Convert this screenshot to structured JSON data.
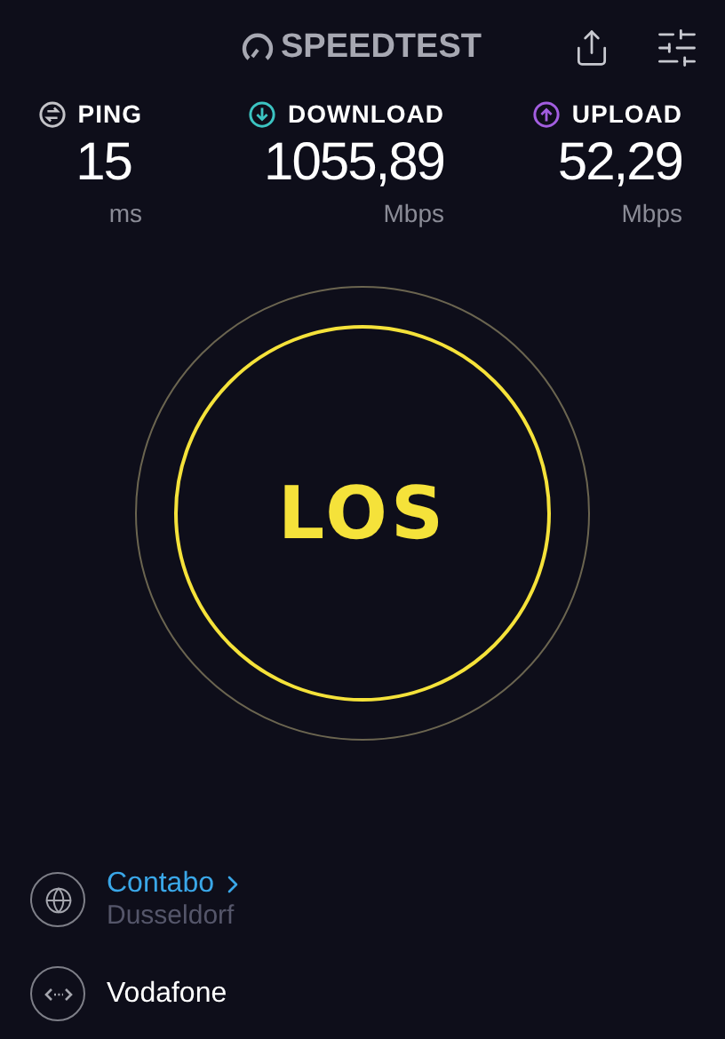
{
  "header": {
    "logo": "SPEEDTEST"
  },
  "metrics": [
    {
      "kind": "ping",
      "label": "PING",
      "value": "15",
      "unit": "ms"
    },
    {
      "kind": "download",
      "label": "DOWNLOAD",
      "value": "1055,89",
      "unit": "Mbps"
    },
    {
      "kind": "upload",
      "label": "UPLOAD",
      "value": "52,29",
      "unit": "Mbps"
    }
  ],
  "go_button": {
    "label": "LOS"
  },
  "server": {
    "name": "Contabo",
    "location": "Dusseldorf"
  },
  "provider": {
    "name": "Vodafone"
  }
}
